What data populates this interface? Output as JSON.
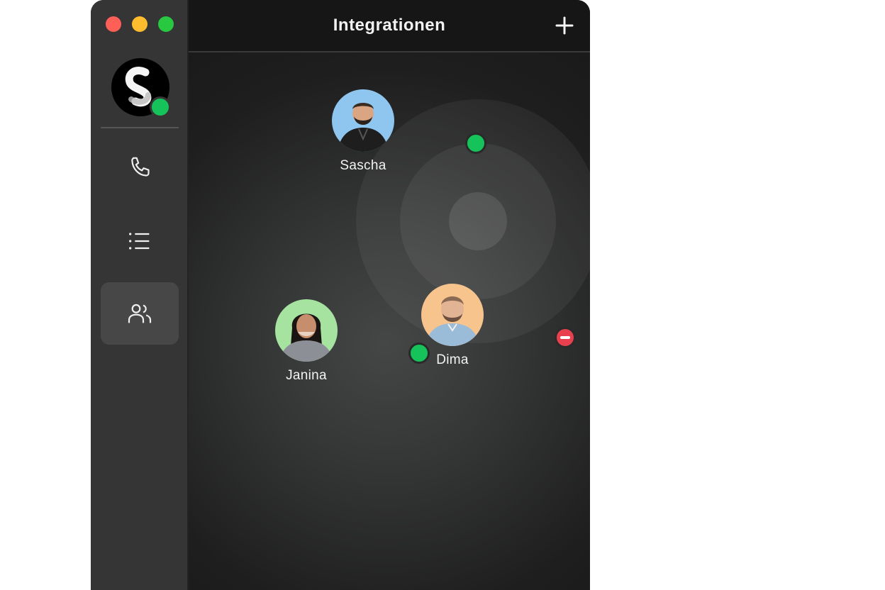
{
  "window": {
    "title": "Integrationen"
  },
  "toolbar": {
    "add_icon": "plus-icon"
  },
  "sidebar": {
    "items": [
      {
        "id": "calls",
        "icon": "phone-icon",
        "active": false
      },
      {
        "id": "list",
        "icon": "list-icon",
        "active": false
      },
      {
        "id": "contacts",
        "icon": "users-icon",
        "active": true
      }
    ]
  },
  "contacts": [
    {
      "name": "Sascha",
      "status": "online",
      "photo_bg": "#8ec6f0"
    },
    {
      "name": "Janina",
      "status": "online",
      "photo_bg": "#a6e3a0"
    },
    {
      "name": "Dima",
      "status": "do-not-disturb",
      "photo_bg": "#f7c48e"
    }
  ],
  "colors": {
    "online": "#16c35a",
    "dnd": "#e8404f",
    "sidebar": "#353535",
    "header": "#161616"
  }
}
